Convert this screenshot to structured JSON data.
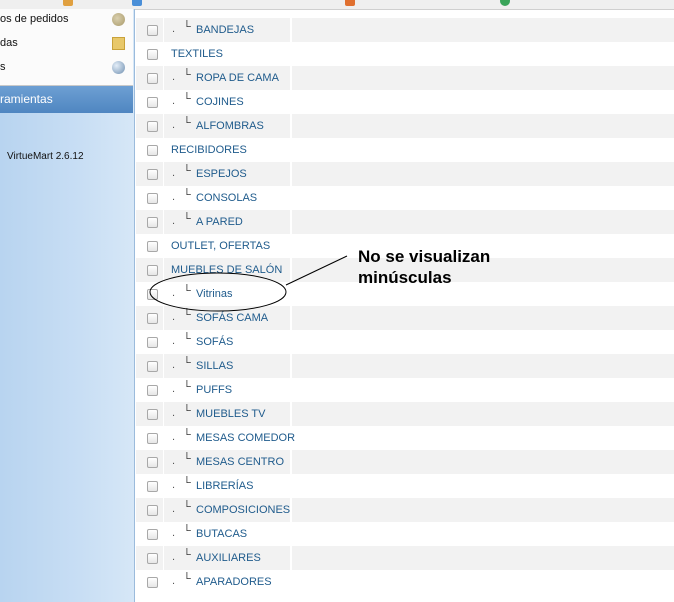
{
  "sidebar": {
    "menu_items": [
      {
        "label": "os de pedidos",
        "icon": "archive-icon"
      },
      {
        "label": "das",
        "icon": "folder-icon"
      },
      {
        "label": "s",
        "icon": "globe-icon"
      }
    ],
    "header": "ramientas",
    "version": "VirtueMart 2.6.12"
  },
  "categories": [
    {
      "name": "BANDEJAS",
      "child": true
    },
    {
      "name": "TEXTILES",
      "child": false
    },
    {
      "name": "ROPA DE CAMA",
      "child": true
    },
    {
      "name": "COJINES",
      "child": true
    },
    {
      "name": "ALFOMBRAS",
      "child": true
    },
    {
      "name": "RECIBIDORES",
      "child": false
    },
    {
      "name": "ESPEJOS",
      "child": true
    },
    {
      "name": "CONSOLAS",
      "child": true
    },
    {
      "name": "A PARED",
      "child": true
    },
    {
      "name": "OUTLET, OFERTAS",
      "child": false
    },
    {
      "name": "MUEBLES DE SALÓN",
      "child": false
    },
    {
      "name": "Vitrinas",
      "child": true
    },
    {
      "name": "SOFÁS CAMA",
      "child": true
    },
    {
      "name": "SOFÁS",
      "child": true
    },
    {
      "name": "SILLAS",
      "child": true
    },
    {
      "name": "PUFFS",
      "child": true
    },
    {
      "name": "MUEBLES TV",
      "child": true
    },
    {
      "name": "MESAS COMEDOR",
      "child": true
    },
    {
      "name": "MESAS CENTRO",
      "child": true
    },
    {
      "name": "LIBRERÍAS",
      "child": true
    },
    {
      "name": "COMPOSICIONES",
      "child": true
    },
    {
      "name": "BUTACAS",
      "child": true
    },
    {
      "name": "AUXILIARES",
      "child": true
    },
    {
      "name": "APARADORES",
      "child": true
    }
  ],
  "tree_marks": {
    "dot": ".",
    "branch": "└"
  },
  "annotation": {
    "line1": "No se visualizan",
    "line2": "minúsculas"
  },
  "colors": {
    "link": "#1f5b8c",
    "sidebar_header": "#4f86c1"
  }
}
